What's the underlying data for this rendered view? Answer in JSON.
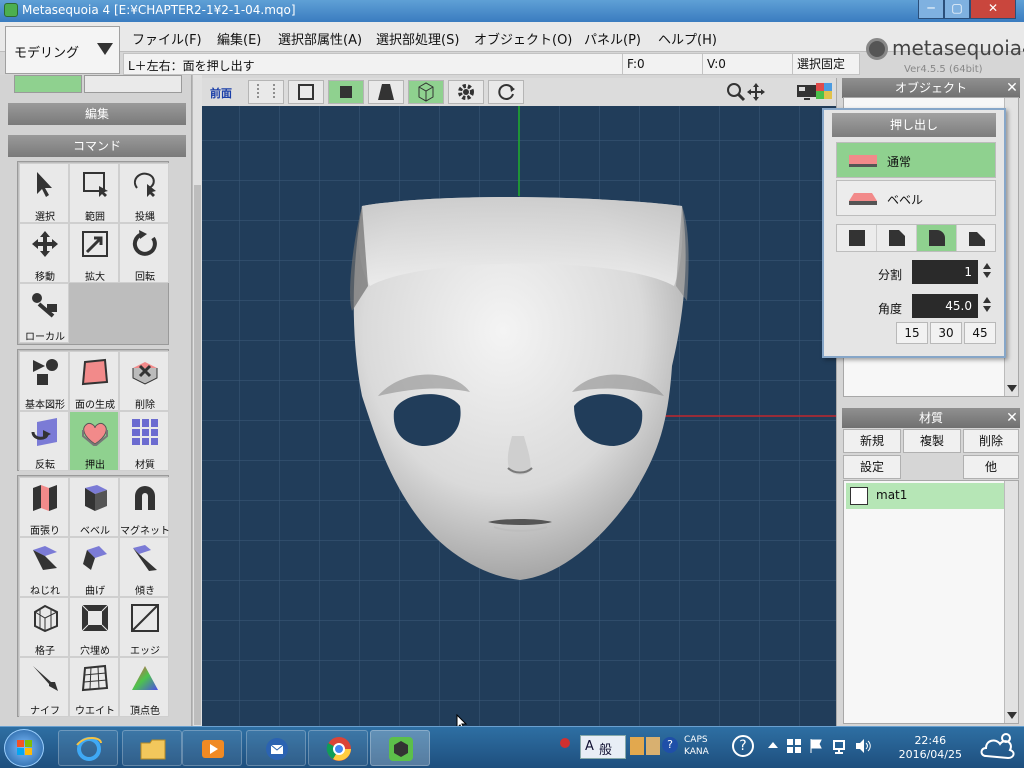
{
  "window": {
    "title": "Metasequoia 4 [E:¥CHAPTER2-1¥2-1-04.mqo]",
    "min_label": "─",
    "max_label": "▢",
    "close_label": "✕"
  },
  "mode_select": {
    "value": "モデリング"
  },
  "menu": [
    "ファイル(F)",
    "編集(E)",
    "選択部属性(A)",
    "選択部処理(S)",
    "オブジェクト(O)",
    "パネル(P)",
    "ヘルプ(H)"
  ],
  "logo": {
    "text": "metasequoia4",
    "version": "Ver4.5.5 (64bit)"
  },
  "status": {
    "hint": "L＋左右：面を押し出す",
    "faces": "F:0",
    "vertices": "V:0",
    "select_lock": "選択固定"
  },
  "left_panel": {
    "edit_header": "編集",
    "command_header": "コマンド",
    "tools_group1": [
      {
        "label": "選択",
        "icon": "cursor-icon"
      },
      {
        "label": "範囲",
        "icon": "rectangle-select-icon"
      },
      {
        "label": "投縄",
        "icon": "lasso-icon"
      },
      {
        "label": "移動",
        "icon": "move-icon"
      },
      {
        "label": "拡大",
        "icon": "scale-icon"
      },
      {
        "label": "回転",
        "icon": "rotate-icon"
      },
      {
        "label": "ローカル",
        "icon": "local-axis-icon"
      }
    ],
    "tools_group2": [
      {
        "label": "基本図形",
        "icon": "primitive-shapes-icon"
      },
      {
        "label": "面の生成",
        "icon": "create-face-icon"
      },
      {
        "label": "削除",
        "icon": "delete-icon"
      },
      {
        "label": "反転",
        "icon": "flip-icon"
      },
      {
        "label": "押出",
        "icon": "extrude-icon",
        "active": true
      },
      {
        "label": "材質",
        "icon": "material-grid-icon"
      }
    ],
    "tools_group3": [
      {
        "label": "面張り",
        "icon": "face-fill-icon"
      },
      {
        "label": "ベベル",
        "icon": "bevel-icon"
      },
      {
        "label": "マグネット",
        "icon": "magnet-icon"
      },
      {
        "label": "ねじれ",
        "icon": "twist-icon"
      },
      {
        "label": "曲げ",
        "icon": "bend-icon"
      },
      {
        "label": "傾き",
        "icon": "tilt-icon"
      },
      {
        "label": "格子",
        "icon": "lattice-icon"
      },
      {
        "label": "穴埋め",
        "icon": "fill-hole-icon"
      },
      {
        "label": "エッジ",
        "icon": "edge-icon"
      },
      {
        "label": "ナイフ",
        "icon": "knife-icon"
      },
      {
        "label": "ウエイト",
        "icon": "weight-icon"
      },
      {
        "label": "頂点色",
        "icon": "vertex-color-icon"
      }
    ]
  },
  "view_toolbar": {
    "front_label": "前面"
  },
  "object_panel": {
    "title": "オブジェクト"
  },
  "extrude": {
    "title": "押し出し",
    "option_normal": "通常",
    "option_bevel": "ベベル",
    "divisions_label": "分割",
    "divisions_value": "1",
    "angle_label": "角度",
    "angle_value": "45.0",
    "presets": [
      "15",
      "30",
      "45"
    ]
  },
  "material_panel": {
    "title": "材質",
    "new": "新規",
    "duplicate": "複製",
    "delete": "削除",
    "settings": "設定",
    "other": "他",
    "items": [
      {
        "name": "mat1"
      }
    ]
  },
  "taskbar": {
    "ime_mode": "A",
    "ime_label": "般",
    "caps": "CAPS",
    "kana": "KANA",
    "time": "22:46",
    "date": "2016/04/25"
  },
  "colors": {
    "active_green": "#8fd18f",
    "viewport_bg": "#213d5a",
    "grid": "#3a5a78",
    "axis_green": "#1fb02a",
    "axis_red": "#c0272d"
  }
}
